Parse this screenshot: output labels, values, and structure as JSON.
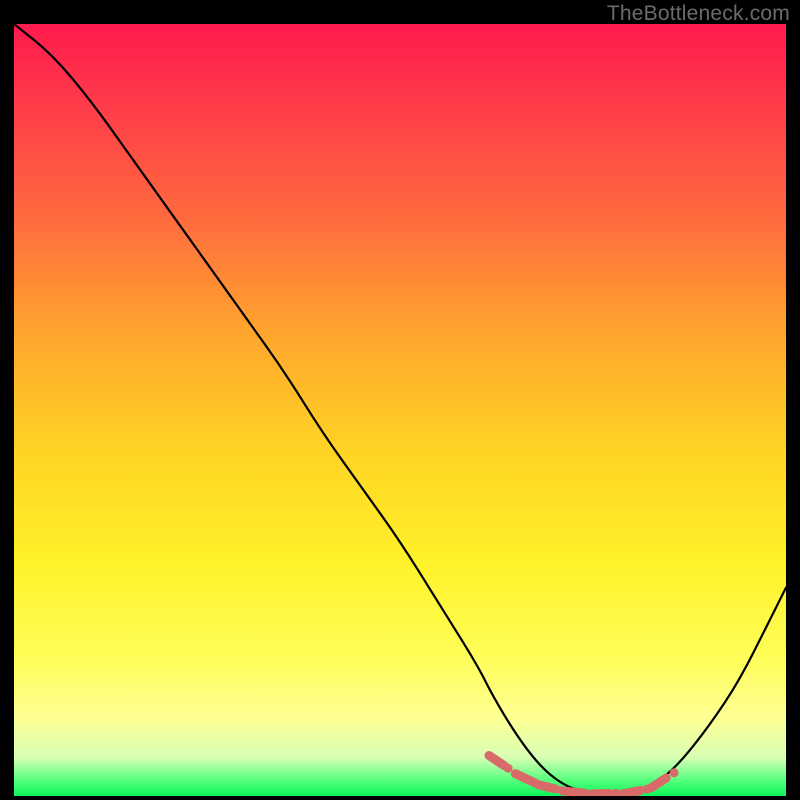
{
  "watermark": "TheBottleneck.com",
  "chart_data": {
    "type": "line",
    "title": "",
    "xlabel": "",
    "ylabel": "",
    "xlim": [
      0,
      100
    ],
    "ylim": [
      0,
      100
    ],
    "grid": false,
    "legend": false,
    "series": [
      {
        "name": "bottleneck-curve",
        "color": "#000000",
        "x": [
          0,
          5,
          10,
          15,
          20,
          25,
          30,
          35,
          40,
          45,
          50,
          55,
          60,
          62,
          65,
          68,
          71,
          74,
          77,
          80,
          83,
          86,
          90,
          94,
          98,
          100
        ],
        "y": [
          100,
          96,
          90,
          83,
          76,
          69,
          62,
          55,
          47,
          40,
          33,
          25,
          17,
          13,
          8,
          4,
          1.5,
          0.4,
          0,
          0.3,
          1.5,
          4,
          9,
          15,
          23,
          27
        ]
      }
    ],
    "markers": {
      "name": "bottleneck-flat-markers",
      "color": "#d86a6a",
      "style": "dash-dot-sequence",
      "x": [
        62.5,
        64,
        66,
        67.5,
        69,
        71,
        72.5,
        74,
        76,
        78,
        80,
        82,
        83.5,
        85.5
      ],
      "y": [
        4.6,
        3.6,
        2.4,
        1.7,
        1.2,
        0.7,
        0.5,
        0.35,
        0.3,
        0.35,
        0.5,
        0.9,
        1.7,
        3
      ]
    }
  }
}
